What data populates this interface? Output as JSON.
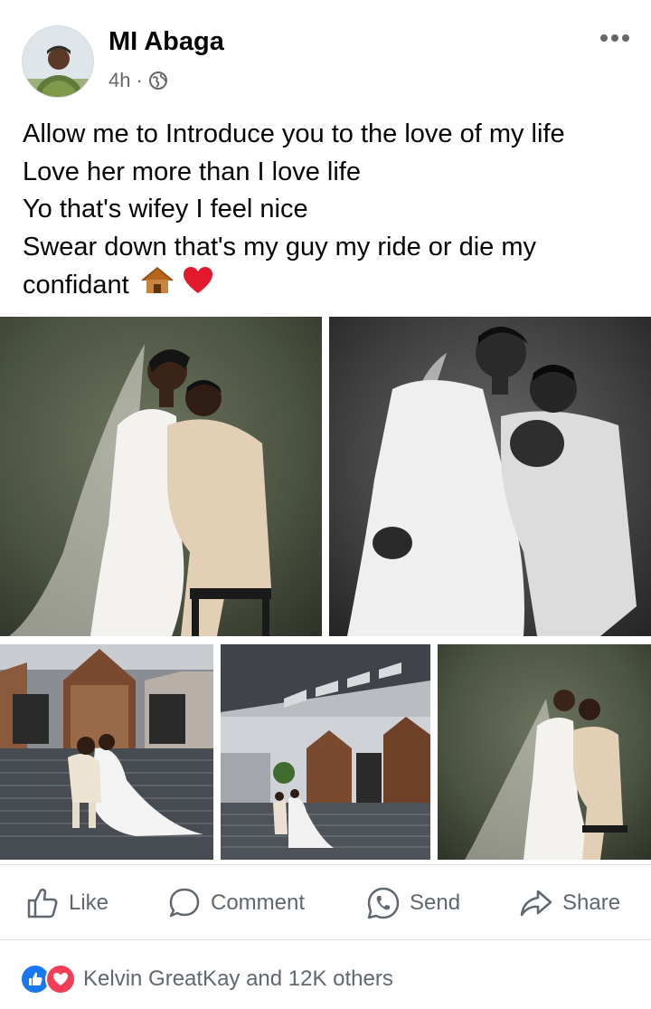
{
  "post": {
    "author": "MI Abaga",
    "time": "4h",
    "separator": "·",
    "privacy_icon": "globe-icon",
    "lines": [
      "Allow me to Introduce you to the love of my life",
      "Love her more than I love life",
      "Yo that's wifey I feel nice",
      "Swear down that's my guy my ride or die my",
      "confidant"
    ],
    "trailing_emojis": [
      "hut-emoji",
      "red-heart-emoji"
    ]
  },
  "photos": [
    {
      "name": "couple-portrait-color",
      "tone": "color"
    },
    {
      "name": "couple-portrait-bw",
      "tone": "bw"
    },
    {
      "name": "couple-church-steps",
      "tone": "color"
    },
    {
      "name": "couple-church-wide",
      "tone": "color"
    },
    {
      "name": "couple-portrait-small",
      "tone": "color"
    }
  ],
  "actions": {
    "like": "Like",
    "comment": "Comment",
    "send": "Send",
    "share": "Share"
  },
  "reactions": {
    "summary": "Kelvin GreatKay and 12K others",
    "icons": [
      "like-reaction-icon",
      "love-reaction-icon"
    ]
  },
  "colors": {
    "like_blue": "#1877f2",
    "love_red": "#f33e58",
    "meta_gray": "#65676b"
  }
}
